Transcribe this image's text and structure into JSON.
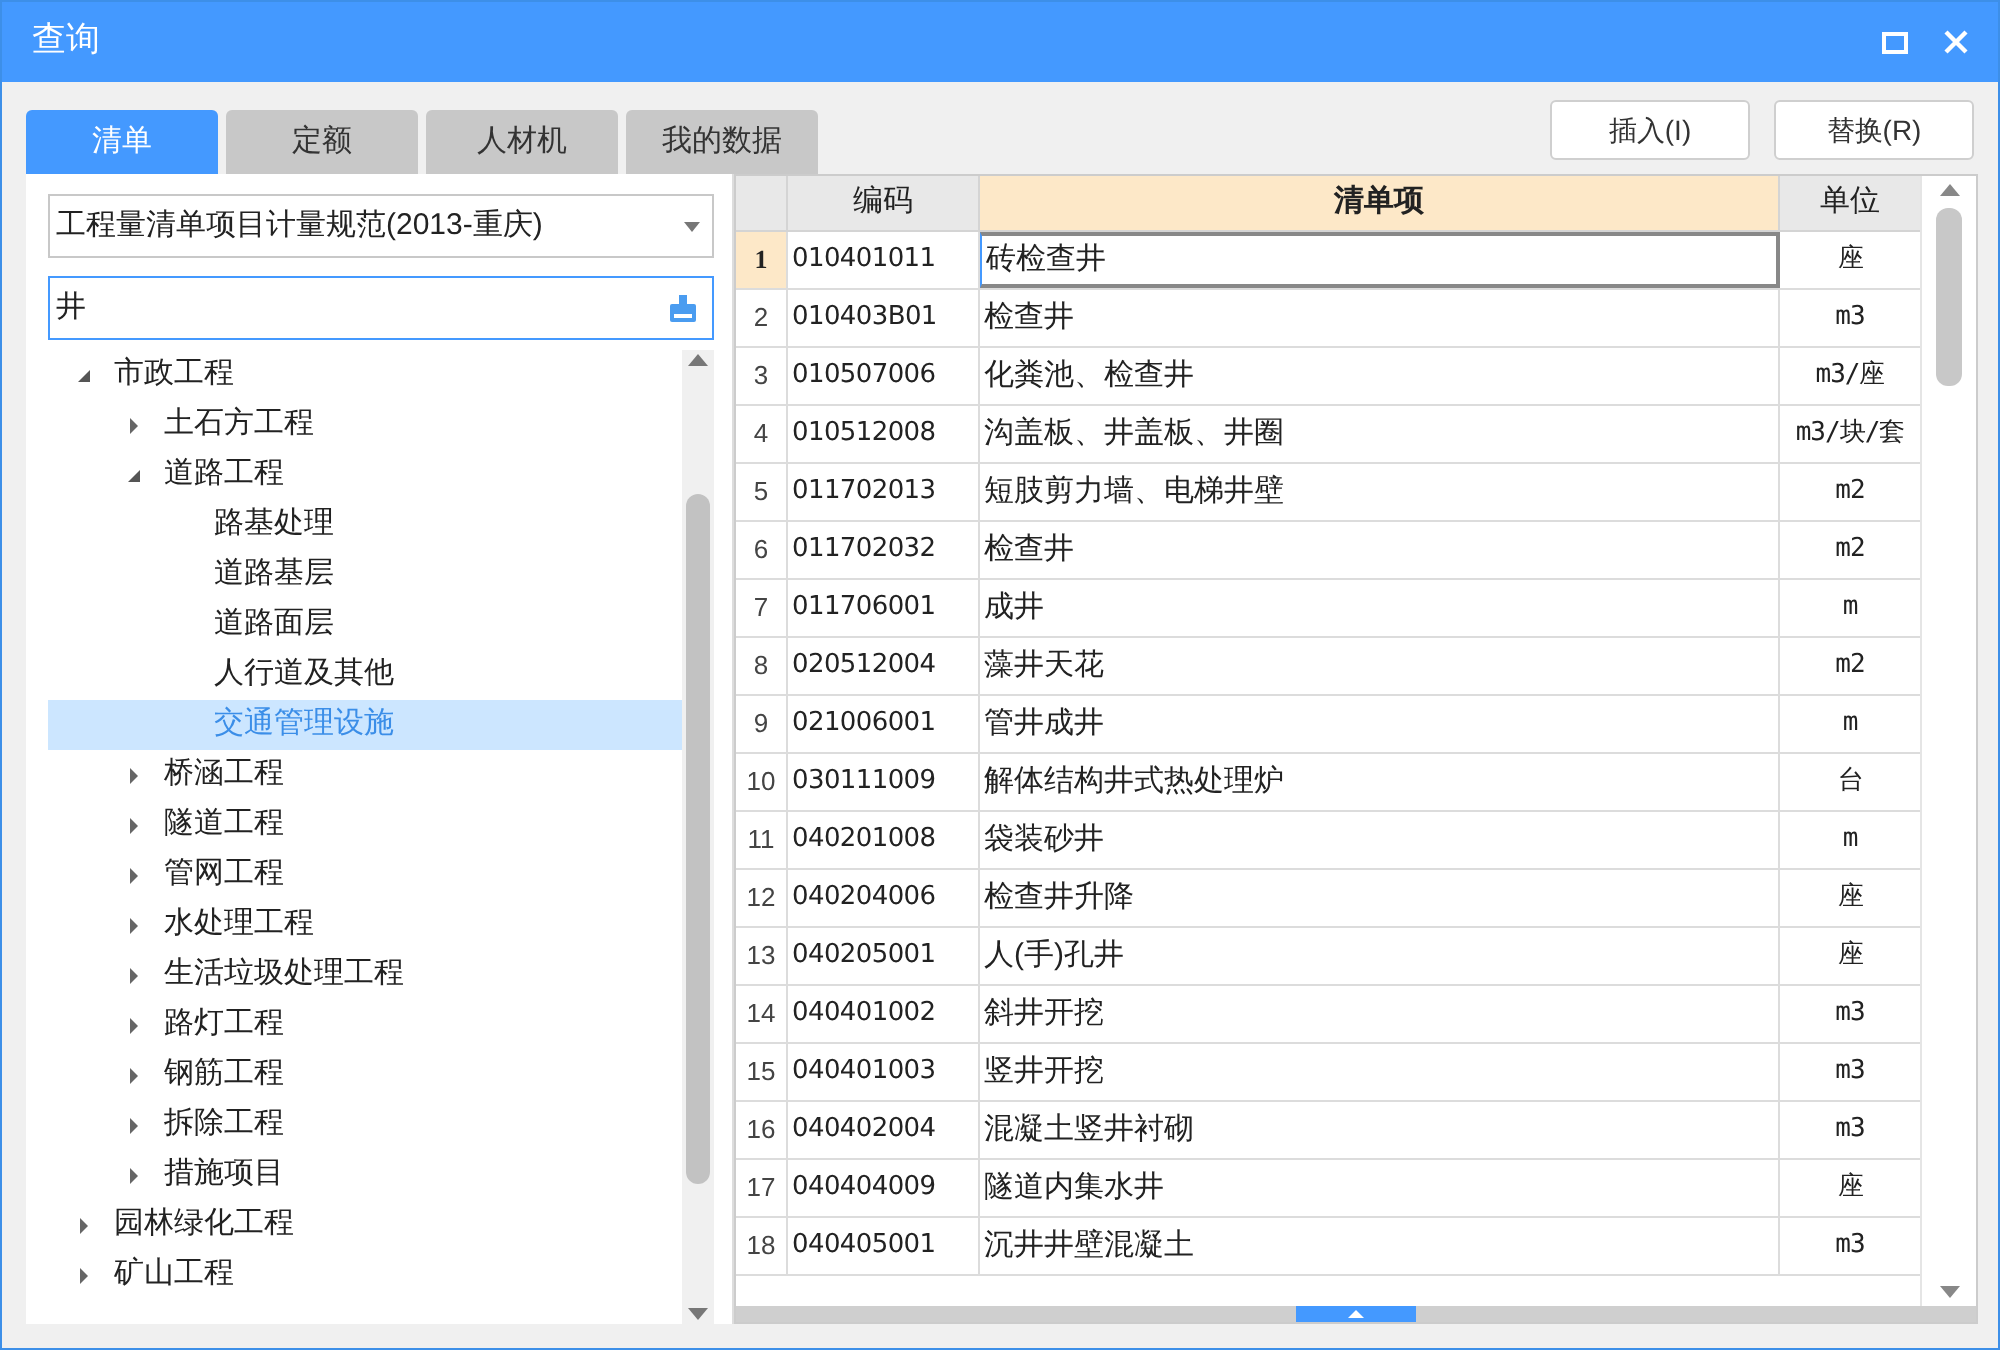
{
  "window": {
    "title": "查询"
  },
  "tabs": [
    {
      "label": "清单",
      "selected": true
    },
    {
      "label": "定额",
      "selected": false
    },
    {
      "label": "人材机",
      "selected": false
    },
    {
      "label": "我的数据",
      "selected": false
    }
  ],
  "buttons": [
    "插入(I)",
    "替换(R)"
  ],
  "standard_select": {
    "value": "工程量清单项目计量规范(2013-重庆)"
  },
  "search": {
    "value": "井"
  },
  "tree": [
    {
      "label": "市政工程",
      "expanded": true,
      "selected": false,
      "children": [
        {
          "label": "土石方工程",
          "expanded": false,
          "selected": false
        },
        {
          "label": "道路工程",
          "expanded": true,
          "selected": false,
          "children": [
            {
              "label": "路基处理",
              "selected": false
            },
            {
              "label": "道路基层",
              "selected": false
            },
            {
              "label": "道路面层",
              "selected": false
            },
            {
              "label": "人行道及其他",
              "selected": false
            },
            {
              "label": "交通管理设施",
              "selected": true
            }
          ]
        },
        {
          "label": "桥涵工程",
          "expanded": false,
          "selected": false
        },
        {
          "label": "隧道工程",
          "expanded": false,
          "selected": false
        },
        {
          "label": "管网工程",
          "expanded": false,
          "selected": false
        },
        {
          "label": "水处理工程",
          "expanded": false,
          "selected": false
        },
        {
          "label": "生活垃圾处理工程",
          "expanded": false,
          "selected": false
        },
        {
          "label": "路灯工程",
          "expanded": false,
          "selected": false
        },
        {
          "label": "钢筋工程",
          "expanded": false,
          "selected": false
        },
        {
          "label": "拆除工程",
          "expanded": false,
          "selected": false
        },
        {
          "label": "措施项目",
          "expanded": false,
          "selected": false
        }
      ]
    },
    {
      "label": "园林绿化工程",
      "expanded": false,
      "selected": false
    },
    {
      "label": "矿山工程",
      "expanded": false,
      "selected": false
    }
  ],
  "table": {
    "columns": [
      "编码",
      "清单项",
      "单位"
    ],
    "rows": [
      {
        "num": "1",
        "code": "010401011",
        "name": "砖检查井",
        "unit": "座",
        "selected": true
      },
      {
        "num": "2",
        "code": "010403B01",
        "name": "检查井",
        "unit": "m3",
        "selected": false
      },
      {
        "num": "3",
        "code": "010507006",
        "name": "化粪池、检查井",
        "unit": "m3/座",
        "selected": false
      },
      {
        "num": "4",
        "code": "010512008",
        "name": "沟盖板、井盖板、井圈",
        "unit": "m3/块/套",
        "selected": false
      },
      {
        "num": "5",
        "code": "011702013",
        "name": "短肢剪力墙、电梯井壁",
        "unit": "m2",
        "selected": false
      },
      {
        "num": "6",
        "code": "011702032",
        "name": "检查井",
        "unit": "m2",
        "selected": false
      },
      {
        "num": "7",
        "code": "011706001",
        "name": "成井",
        "unit": "m",
        "selected": false
      },
      {
        "num": "8",
        "code": "020512004",
        "name": "藻井天花",
        "unit": "m2",
        "selected": false
      },
      {
        "num": "9",
        "code": "021006001",
        "name": "管井成井",
        "unit": "m",
        "selected": false
      },
      {
        "num": "10",
        "code": "030111009",
        "name": "解体结构井式热处理炉",
        "unit": "台",
        "selected": false
      },
      {
        "num": "11",
        "code": "040201008",
        "name": "袋装砂井",
        "unit": "m",
        "selected": false
      },
      {
        "num": "12",
        "code": "040204006",
        "name": "检查井升降",
        "unit": "座",
        "selected": false
      },
      {
        "num": "13",
        "code": "040205001",
        "name": "人(手)孔井",
        "unit": "座",
        "selected": false
      },
      {
        "num": "14",
        "code": "040401002",
        "name": "斜井开挖",
        "unit": "m3",
        "selected": false
      },
      {
        "num": "15",
        "code": "040401003",
        "name": "竖井开挖",
        "unit": "m3",
        "selected": false
      },
      {
        "num": "16",
        "code": "040402004",
        "name": "混凝土竖井衬砌",
        "unit": "m3",
        "selected": false
      },
      {
        "num": "17",
        "code": "040404009",
        "name": "隧道内集水井",
        "unit": "座",
        "selected": false
      },
      {
        "num": "18",
        "code": "040405001",
        "name": "沉井井壁混凝土",
        "unit": "m3",
        "selected": false
      }
    ]
  }
}
